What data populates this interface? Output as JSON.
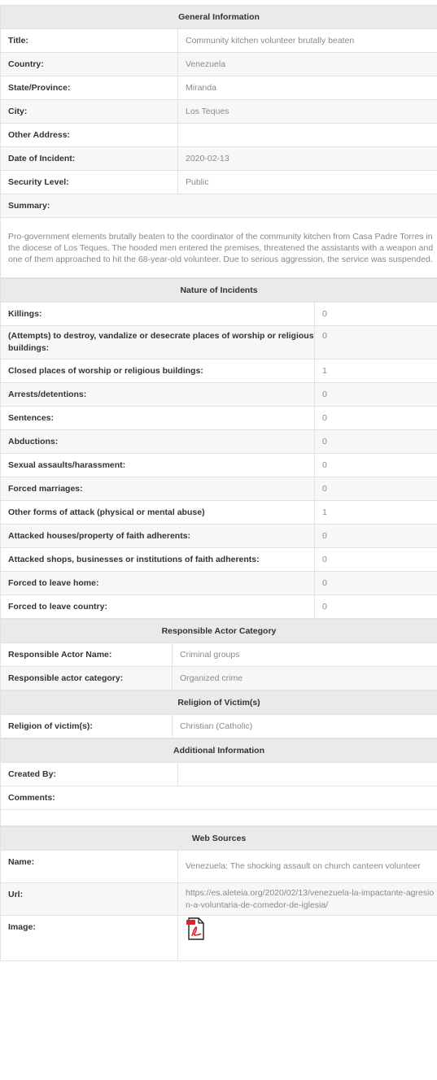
{
  "general": {
    "header": "General Information",
    "rows": [
      {
        "label": "Title:",
        "value": "Community kitchen volunteer brutally beaten"
      },
      {
        "label": "Country:",
        "value": "Venezuela"
      },
      {
        "label": "State/Province:",
        "value": "Miranda"
      },
      {
        "label": "City:",
        "value": "Los Teques"
      },
      {
        "label": "Other Address:",
        "value": ""
      },
      {
        "label": "Date of Incident:",
        "value": "2020-02-13"
      },
      {
        "label": "Security Level:",
        "value": "Public"
      }
    ],
    "summary_label": "Summary:",
    "summary_text": "Pro-government elements brutally beaten to the coordinator of the community kitchen from Casa Padre Torres in the diocese of Los Teques. The hooded men entered the premises, threatened the assistants with a weapon and one of them approached to hit the 68-year-old volunteer. Due to serious aggression, the service was suspended."
  },
  "nature": {
    "header": "Nature of Incidents",
    "rows": [
      {
        "label": "Killings:",
        "value": "0"
      },
      {
        "label": "(Attempts) to destroy, vandalize or desecrate places of worship or religious buildings:",
        "value": "0"
      },
      {
        "label": "Closed places of worship or religious buildings:",
        "value": "1"
      },
      {
        "label": "Arrests/detentions:",
        "value": "0"
      },
      {
        "label": "Sentences:",
        "value": "0"
      },
      {
        "label": "Abductions:",
        "value": "0"
      },
      {
        "label": "Sexual assaults/harassment:",
        "value": "0"
      },
      {
        "label": "Forced marriages:",
        "value": "0"
      },
      {
        "label": "Other forms of attack (physical or mental abuse)",
        "value": "1"
      },
      {
        "label": "Attacked houses/property of faith adherents:",
        "value": "0"
      },
      {
        "label": "Attacked shops, businesses or institutions of faith adherents:",
        "value": "0"
      },
      {
        "label": "Forced to leave home:",
        "value": "0"
      },
      {
        "label": "Forced to leave country:",
        "value": "0"
      }
    ]
  },
  "actor": {
    "header": "Responsible Actor Category",
    "rows": [
      {
        "label": "Responsible Actor Name:",
        "value": "Criminal groups"
      },
      {
        "label": "Responsible actor category:",
        "value": "Organized crime"
      }
    ]
  },
  "religion": {
    "header": "Religion of Victim(s)",
    "rows": [
      {
        "label": "Religion of victim(s):",
        "value": "Christian (Catholic)"
      }
    ]
  },
  "additional": {
    "header": "Additional Information",
    "created_by_label": "Created By:",
    "created_by_value": "",
    "comments_label": "Comments:"
  },
  "sources": {
    "header": "Web Sources",
    "name_label": "Name:",
    "name_value": "Venezuela: The shocking assault on church canteen volunteer",
    "url_label": "Url:",
    "url_value": "https://es.aleteia.org/2020/02/13/venezuela-la-impactante-agresion-a-voluntaria-de-comedor-de-iglesia/",
    "image_label": "Image:",
    "image_icon": "pdf-file-icon"
  }
}
